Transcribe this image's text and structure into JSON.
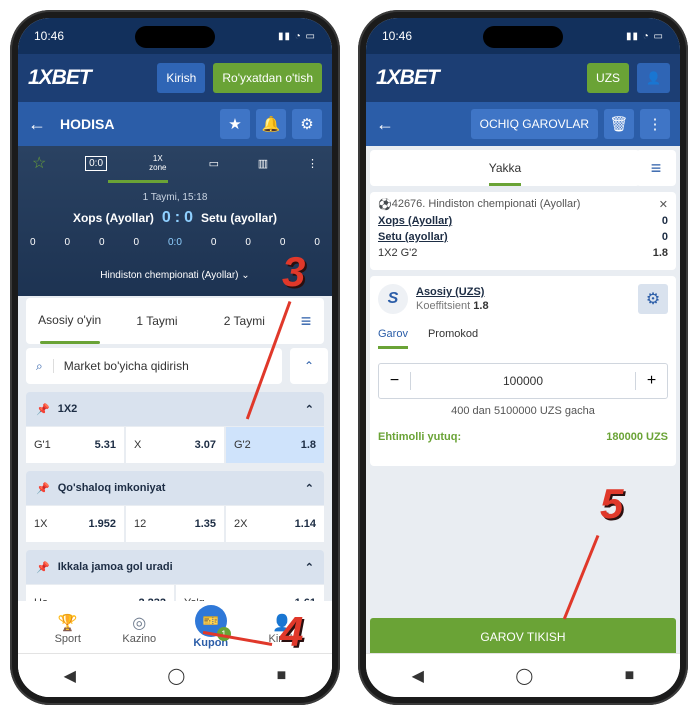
{
  "left": {
    "time": "10:46",
    "brand": "1XBET",
    "login": "Kirish",
    "register": "Ro'yxatdan o'tish",
    "page_title": "HODISA",
    "match_tabs": [
      "0:0",
      "1X zone"
    ],
    "period": "1 Taymi, 15:18",
    "team1": "Xops (Ayollar)",
    "team2": "Setu (ayollar)",
    "score1": "0",
    "score_sep": ":",
    "score2": "0",
    "stat_vals": [
      "0",
      "0",
      "0",
      "0",
      "0:0",
      "0",
      "0",
      "0",
      "0"
    ],
    "league": "Hindiston chempionati (Ayollar)",
    "market_tabs": [
      "Asosiy o'yin",
      "1 Taymi",
      "2 Taymi"
    ],
    "search_placeholder": "Market bo'yicha qidirish",
    "markets": [
      {
        "title": "1X2",
        "odds": [
          [
            "G'1",
            "5.31"
          ],
          [
            "X",
            "3.07"
          ],
          [
            "G'2",
            "1.8"
          ]
        ]
      },
      {
        "title": "Qo'shaloq imkoniyat",
        "odds": [
          [
            "1X",
            "1.952"
          ],
          [
            "12",
            "1.35"
          ],
          [
            "2X",
            "1.14"
          ]
        ]
      },
      {
        "title": "Ikkala jamoa gol uradi",
        "odds": [
          [
            "Ha",
            "2.232"
          ],
          [
            "Yo'q",
            "1.61"
          ]
        ]
      }
    ],
    "nav": [
      "Sport",
      "Kazino",
      "Kupon",
      "Kirish"
    ],
    "badge": "1",
    "n3": "3",
    "n4": "4"
  },
  "right": {
    "time": "10:46",
    "brand": "1XBET",
    "currency": "UZS",
    "open_bets": "OCHIQ GAROVLAR",
    "tab": "Yakka",
    "event_header": "42676. Hindiston chempionati (Ayollar)",
    "team1": "Xops (Ayollar)",
    "team1_score": "0",
    "team2": "Setu (ayollar)",
    "team2_score": "0",
    "bet_type": "1X2 G'2",
    "bet_odd": "1.8",
    "account": "Asosiy (UZS)",
    "coef_label": "Koeffitsient",
    "coef": "1.8",
    "tab_garov": "Garov",
    "tab_promo": "Promokod",
    "stake": "100000",
    "range": "400 dan 5100000 UZS gacha",
    "win_label": "Ehtimolli yutuq:",
    "win_value": "180000 UZS",
    "place": "GAROV TIKISH",
    "n5": "5"
  }
}
